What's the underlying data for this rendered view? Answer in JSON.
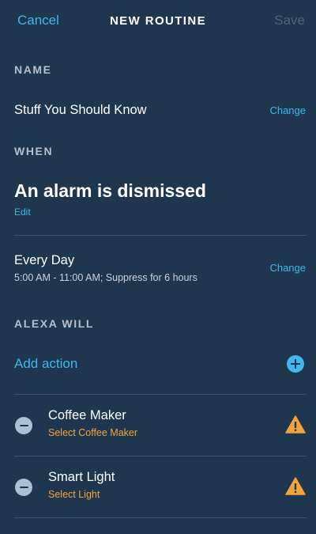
{
  "header": {
    "cancel_label": "Cancel",
    "title": "NEW ROUTINE",
    "save_label": "Save"
  },
  "name_section": {
    "label": "NAME",
    "value": "Stuff You Should Know",
    "change_label": "Change"
  },
  "when_section": {
    "label": "WHEN",
    "trigger": "An alarm is dismissed",
    "edit_label": "Edit",
    "schedule_title": "Every Day",
    "schedule_detail": "5:00 AM - 11:00 AM; Suppress for 6 hours",
    "change_label": "Change"
  },
  "alexa_will": {
    "label": "ALEXA WILL",
    "add_action_label": "Add action",
    "actions": [
      {
        "title": "Coffee Maker",
        "subtitle": "Select Coffee Maker"
      },
      {
        "title": "Smart Light",
        "subtitle": "Select Light"
      }
    ]
  },
  "colors": {
    "background": "#1f364f",
    "accent": "#3fb7ef",
    "warning": "#f2a43a"
  }
}
